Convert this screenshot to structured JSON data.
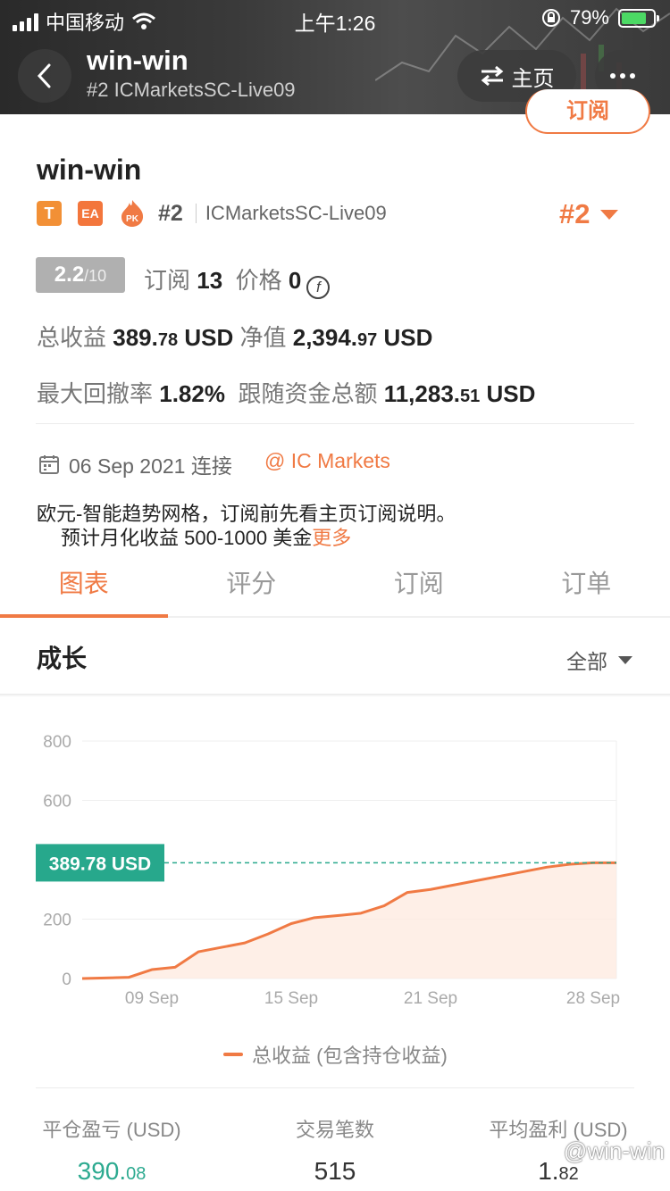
{
  "status_bar": {
    "carrier": "中国移动",
    "time": "上午1:26",
    "battery": "79%",
    "battery_level": 0.79
  },
  "nav": {
    "title": "win-win",
    "subtitle": "#2 ICMarketsSC-Live09",
    "home_label": "主页",
    "subscribe_label": "订阅"
  },
  "profile": {
    "name": "win-win",
    "tags": [
      "T",
      "EA",
      "PK"
    ],
    "rank": "#2",
    "server": "ICMarketsSC-Live09",
    "rank_big": "#2",
    "score": "2.2",
    "score_max": "/10",
    "subscribe_label": "订阅",
    "subscribe_count": "13",
    "price_label": "价格",
    "price_value": "0",
    "total_profit_label": "总收益",
    "total_profit_int": "389.",
    "total_profit_dec": "78",
    "total_profit_unit": "USD",
    "equity_label": "净值",
    "equity_int": "2,394.",
    "equity_dec": "97",
    "equity_unit": "USD",
    "max_dd_label": "最大回撤率",
    "max_dd_value": "1.82%",
    "follow_label": "跟随资金总额",
    "follow_int": "11,283.",
    "follow_dec": "51",
    "follow_unit": "USD",
    "connect_date": "06 Sep 2021 连接",
    "broker": "@ IC Markets",
    "desc_line1": "欧元-智能趋势网格，订阅前先看主页订阅说明。",
    "desc_line2": "预计月化收益 500-1000 美金",
    "more": "更多"
  },
  "tabs": [
    {
      "label": "图表",
      "active": true
    },
    {
      "label": "评分",
      "active": false
    },
    {
      "label": "订阅",
      "active": false
    },
    {
      "label": "订单",
      "active": false
    }
  ],
  "section": {
    "title": "成长",
    "range": "全部"
  },
  "chart_data": {
    "type": "area",
    "y_ticks": [
      "800",
      "600",
      "200",
      "0"
    ],
    "x_ticks": [
      "09 Sep",
      "15 Sep",
      "21 Sep",
      "28 Sep"
    ],
    "ylim": [
      0,
      800
    ],
    "current_label": "389.78 USD",
    "current_value": 389.78,
    "series": [
      {
        "name": "总收益 (包含持仓收益)",
        "x": [
          "06 Sep",
          "07 Sep",
          "08 Sep",
          "09 Sep",
          "10 Sep",
          "11 Sep",
          "12 Sep",
          "13 Sep",
          "14 Sep",
          "15 Sep",
          "16 Sep",
          "17 Sep",
          "18 Sep",
          "19 Sep",
          "20 Sep",
          "21 Sep",
          "22 Sep",
          "23 Sep",
          "24 Sep",
          "25 Sep",
          "26 Sep",
          "27 Sep",
          "28 Sep",
          "29 Sep"
        ],
        "values": [
          0,
          2,
          4,
          30,
          38,
          90,
          105,
          120,
          150,
          185,
          205,
          212,
          220,
          245,
          290,
          300,
          315,
          330,
          345,
          360,
          375,
          385,
          390,
          390
        ]
      }
    ],
    "colors": {
      "line": "#f07a44",
      "fill": "#fde9df",
      "current": "#27a88c"
    }
  },
  "bottom_stats": [
    {
      "label": "平仓盈亏 (USD)",
      "int": "390.",
      "dec": "08",
      "green": true
    },
    {
      "label": "交易笔数",
      "int": "515",
      "dec": "",
      "green": false
    },
    {
      "label": "平均盈利 (USD)",
      "int": "1.",
      "dec": "82",
      "green": false
    }
  ],
  "watermark": "@win-win"
}
